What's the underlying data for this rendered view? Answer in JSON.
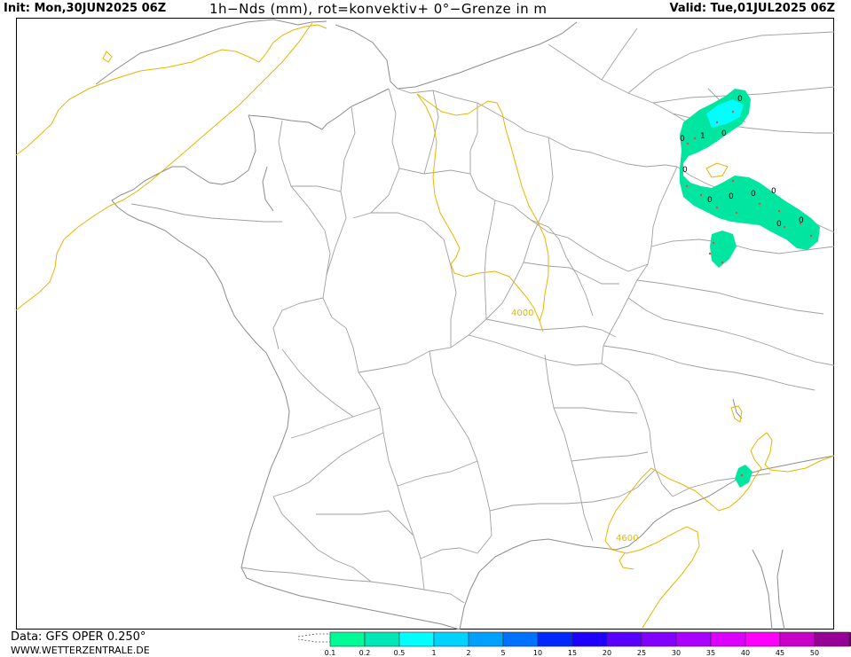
{
  "header": {
    "init": "Init: Mon,30JUN2025 06Z",
    "title": "1h−Nds (mm), rot=konvektiv+ 0°−Grenze in m",
    "valid": "Valid: Tue,01JUL2025 06Z"
  },
  "footer": {
    "data_source": "Data: GFS OPER 0.250°",
    "url": "WWW.WETTERZENTRALE.DE"
  },
  "isoline_labels": [
    "4000",
    "4600"
  ],
  "precip_values": [
    "0",
    "1",
    "0",
    "0",
    "0",
    "0",
    "0",
    "0",
    "0",
    "0",
    "0"
  ],
  "legend": {
    "labels": [
      "0.1",
      "0.2",
      "0.5",
      "1",
      "2",
      "5",
      "10",
      "15",
      "20",
      "25",
      "30",
      "35",
      "40",
      "45",
      "50"
    ],
    "colors": [
      "#00fa96",
      "#00e6b4",
      "#00ffff",
      "#00d2ff",
      "#00a0ff",
      "#0070ff",
      "#0028ff",
      "#1e00ff",
      "#5a00ff",
      "#8200ff",
      "#aa00ff",
      "#dc00ff",
      "#ff00ff",
      "#c800c8",
      "#960096",
      "#640064"
    ]
  },
  "colors": {
    "freezing_level_line": "#e8b400",
    "border_line": "#8c8c8c",
    "coast_line": "#8c8c8c",
    "precip_light": "#00e6a0",
    "precip_heavier": "#00ffff",
    "convective_marker": "#ff3c3c"
  }
}
